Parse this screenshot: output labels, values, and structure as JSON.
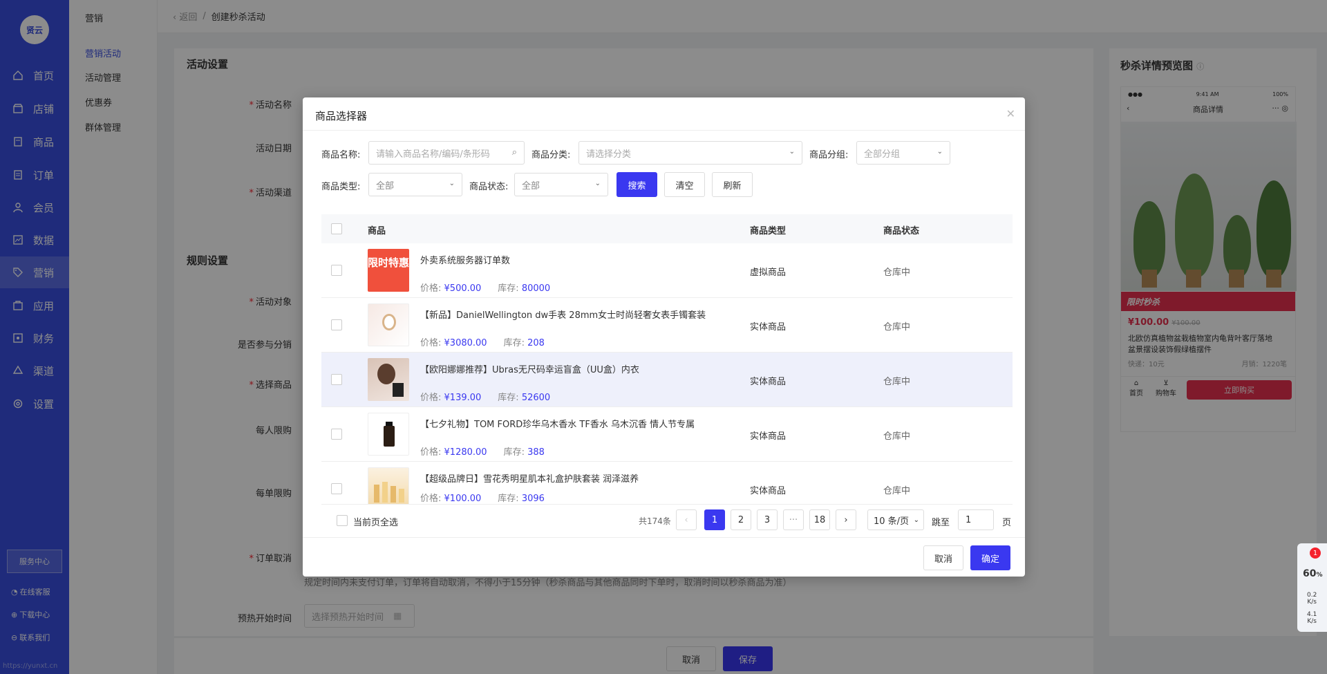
{
  "app": {
    "logo_text": "贤云",
    "footer_url": "https://yunxt.cn"
  },
  "nav": {
    "items": [
      {
        "label": "首页",
        "icon": "home-icon"
      },
      {
        "label": "店铺",
        "icon": "shop-icon"
      },
      {
        "label": "商品",
        "icon": "goods-icon"
      },
      {
        "label": "订单",
        "icon": "order-icon"
      },
      {
        "label": "会员",
        "icon": "member-icon"
      },
      {
        "label": "数据",
        "icon": "chart-icon"
      },
      {
        "label": "营销",
        "icon": "tag-icon"
      },
      {
        "label": "应用",
        "icon": "app-icon"
      },
      {
        "label": "财务",
        "icon": "finance-icon"
      },
      {
        "label": "渠道",
        "icon": "channel-icon"
      },
      {
        "label": "设置",
        "icon": "gear-icon"
      }
    ],
    "active_index": 6,
    "service_center": "服务中心",
    "links": [
      "在线客服",
      "下载中心",
      "联系我们"
    ]
  },
  "subnav": {
    "title": "营销",
    "items": [
      "营销活动",
      "活动管理",
      "优惠券",
      "群体管理"
    ],
    "active_index": 0
  },
  "breadcrumb": {
    "back": "返回",
    "current": "创建秒杀活动"
  },
  "form": {
    "activity_section": "活动设置",
    "rule_section": "规则设置",
    "labels": {
      "name": "活动名称",
      "date": "活动日期",
      "channel": "活动渠道",
      "target": "活动对象",
      "distribution": "是否参与分销",
      "goods": "选择商品",
      "per_person": "每人限购",
      "per_order": "每单限购",
      "cancel": "订单取消",
      "preheat": "预热开始时间"
    },
    "cancel_hint": "规定时间内未支付订单，订单将自动取消，不得小于15分钟（秒杀商品与其他商品同时下单时，取消时间以秒杀商品为准）",
    "preheat_placeholder": "选择预热开始时间",
    "cancel_btn": "取消",
    "save_btn": "保存"
  },
  "preview": {
    "title": "秒杀详情预览图",
    "phone_time": "9:41 AM",
    "phone_battery": "100%",
    "phone_title": "商品详情",
    "flash_label": "限时秒杀",
    "price": "¥100.00",
    "orig_price": "¥100.00",
    "product_name": "北欧仿真植物盆栽植物室内龟背叶客厅落地盆景摆设装饰假绿植摆件",
    "shipping": "快递：10元",
    "monthly_sales": "月销：1220笔",
    "tab_home": "首页",
    "tab_cart": "购物车",
    "buy_now": "立即购买"
  },
  "modal": {
    "title": "商品选择器",
    "filters": {
      "name_label": "商品名称:",
      "name_placeholder": "请输入商品名称/编码/条形码",
      "category_label": "商品分类:",
      "category_placeholder": "请选择分类",
      "group_label": "商品分组:",
      "group_value": "全部分组",
      "type_label": "商品类型:",
      "type_value": "全部",
      "status_label": "商品状态:",
      "status_value": "全部",
      "search_btn": "搜索",
      "clear_btn": "清空",
      "refresh_btn": "刷新"
    },
    "columns": [
      "商品",
      "商品类型",
      "商品状态"
    ],
    "price_label": "价格:",
    "stock_label": "库存:",
    "rows": [
      {
        "name": "外卖系统服务器订单数",
        "price": "¥500.00",
        "stock": "80000",
        "type": "虚拟商品",
        "status": "仓库中",
        "thumb": "限时特惠"
      },
      {
        "name": "【新品】DanielWellington dw手表 28mm女士时尚轻奢女表手镯套装",
        "price": "¥3080.00",
        "stock": "208",
        "type": "实体商品",
        "status": "仓库中",
        "thumb": ""
      },
      {
        "name": "【欧阳娜娜推荐】Ubras无尺码幸运盲盒（UU盒）内衣",
        "price": "¥139.00",
        "stock": "52600",
        "type": "实体商品",
        "status": "仓库中",
        "thumb": ""
      },
      {
        "name": "【七夕礼物】TOM FORD珍华乌木香水 TF香水 乌木沉香 情人节专属",
        "price": "¥1280.00",
        "stock": "388",
        "type": "实体商品",
        "status": "仓库中",
        "thumb": ""
      },
      {
        "name": "【超级品牌日】雪花秀明星肌本礼盒护肤套装 润泽滋养",
        "price": "¥100.00",
        "stock": "3096",
        "type": "实体商品",
        "status": "仓库中",
        "thumb": ""
      }
    ],
    "highlight_row": 2,
    "select_all_page": "当前页全选",
    "pagination": {
      "total": "共174条",
      "pages": [
        "1",
        "2",
        "3",
        "···",
        "18"
      ],
      "current": "1",
      "page_size": "10 条/页",
      "goto_label": "跳至",
      "goto_value": "1",
      "page_unit": "页"
    },
    "cancel_btn": "取消",
    "confirm_btn": "确定"
  },
  "net_widget": {
    "badge": "1",
    "cpu": "60",
    "cpu_unit": "%",
    "up": "0.2",
    "up_unit": "K/s",
    "down": "4.1",
    "down_unit": "K/s"
  },
  "colors": {
    "primary": "#3a38f0",
    "nav_bg": "#3a4fe0",
    "flash": "#e8304f"
  }
}
